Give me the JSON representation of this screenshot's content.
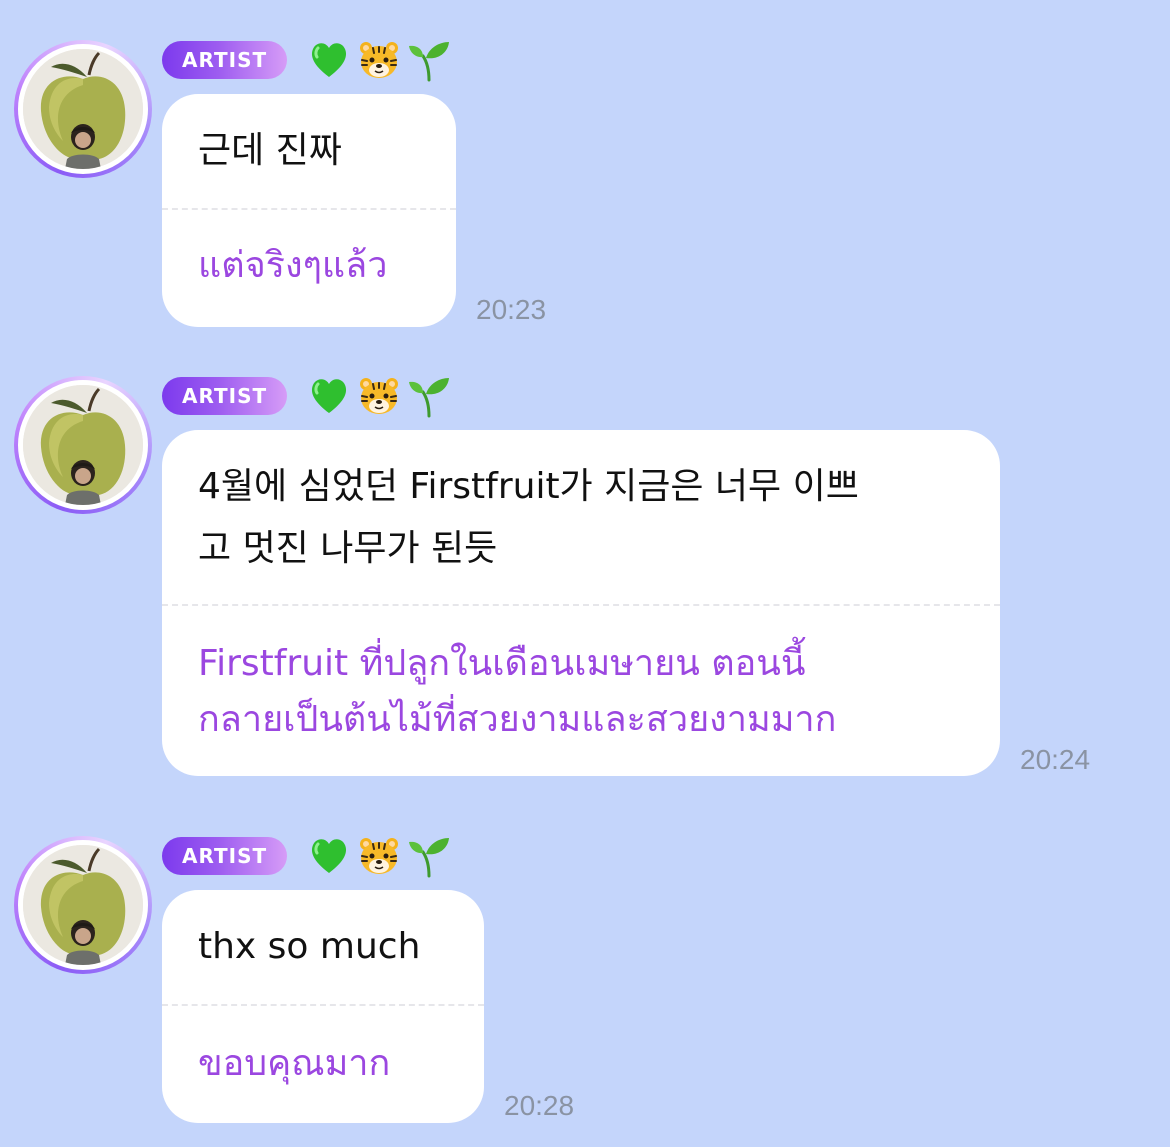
{
  "chat": {
    "messages": [
      {
        "sender_badge": "ARTIST",
        "emojis": [
          "green-heart",
          "tiger-face",
          "seedling"
        ],
        "text": "근데 진짜",
        "translation": "แต่จริงๆแล้ว",
        "time": "20:23"
      },
      {
        "sender_badge": "ARTIST",
        "emojis": [
          "green-heart",
          "tiger-face",
          "seedling"
        ],
        "text_lines": [
          "4월에 심었던 Firstfruit가 지금은 너무 이쁘",
          "고 멋진 나무가 된듯"
        ],
        "translation_lines": [
          "Firstfruit ที่ปลูกในเดือนเมษายน ตอนนี้",
          "กลายเป็นต้นไม้ที่สวยงามและสวยงามมาก"
        ],
        "time": "20:24"
      },
      {
        "sender_badge": "ARTIST",
        "emojis": [
          "green-heart",
          "tiger-face",
          "seedling"
        ],
        "text": "thx so much",
        "translation": "ขอบคุณมาก",
        "time": "20:28"
      }
    ]
  },
  "colors": {
    "background": "#c4d5fb",
    "bubble": "#ffffff",
    "translation_text": "#9b47e0",
    "timestamp": "#8a93a3",
    "badge_gradient_start": "#7c3aed",
    "badge_gradient_end": "#d69cf7"
  }
}
